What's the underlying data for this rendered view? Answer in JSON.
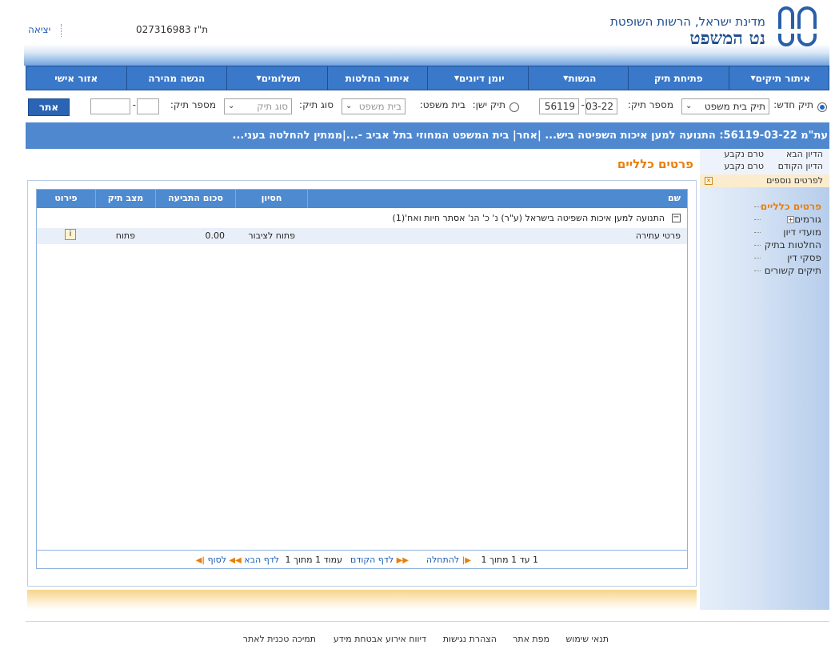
{
  "header": {
    "site_subtitle": "מדינת ישראל, הרשות השופטת",
    "site_title": "נט המשפט",
    "user_id": "ת\"ז 027316983",
    "logout": "יציאה"
  },
  "nav": [
    {
      "label": "איתור תיקים",
      "dropdown": true
    },
    {
      "label": "פתיחת תיק",
      "dropdown": false
    },
    {
      "label": "הגשות",
      "dropdown": true
    },
    {
      "label": "יומן דיונים",
      "dropdown": true
    },
    {
      "label": "איתור החלטות",
      "dropdown": false
    },
    {
      "label": "תשלומים",
      "dropdown": true
    },
    {
      "label": "הגשה מהירה",
      "dropdown": false
    },
    {
      "label": "אזור אישי",
      "dropdown": false
    }
  ],
  "search": {
    "new_case_label": "תיק חדש:",
    "new_case_type": "תיק בית משפט",
    "case_number_label": "מספר תיק:",
    "case_number_month": "03-22",
    "case_number_sep": "-",
    "case_number_id": "56119",
    "old_case_label": "תיק ישן:",
    "court_label": "בית משפט:",
    "court_placeholder": "בית משפט",
    "case_type_label": "סוג תיק:",
    "case_type_placeholder": "סוג תיק",
    "old_case_number_label": "מספר תיק:",
    "old_case_sep": "-",
    "go_button": "אתר"
  },
  "case_banner": "עת\"מ 56119-03-22: התנועה למען איכות השפיטה ביש... |אחר| בית המשפט המחוזי בתל אביב -...|ממתין להחלטה בעני...",
  "side": {
    "next_hearing_label": "הדיון הבא",
    "next_hearing_value": "טרם נקבע",
    "prev_hearing_label": "הדיון הקודם",
    "prev_hearing_value": "טרם נקבע",
    "more_details": "לפרטים נוספים",
    "tree": [
      {
        "label": "פרטים כלליים",
        "active": true,
        "expandable": false
      },
      {
        "label": "גורמים",
        "active": false,
        "expandable": true
      },
      {
        "label": "מועדי דיון",
        "active": false,
        "expandable": false
      },
      {
        "label": "החלטות בתיק",
        "active": false,
        "expandable": false
      },
      {
        "label": "פסקי דין",
        "active": false,
        "expandable": false
      },
      {
        "label": "תיקים קשורים",
        "active": false,
        "expandable": false
      }
    ]
  },
  "main": {
    "section_title": "פרטים כלליים",
    "columns": [
      "שם",
      "חסיון",
      "סכום התביעה",
      "מצב תיק",
      "פירוט"
    ],
    "group_label": "התנועה למען איכות השפיטה בישראל (ע\"ר) נ' כ' הנ' אסתר חיות ואח'(1)",
    "rows": [
      {
        "name": "פרטי עתירה",
        "privacy": "פתוח לציבור",
        "amount": "0.00",
        "status": "פתוח"
      }
    ],
    "pager": {
      "range": "1 עד 1 מתוך 1",
      "first": "להתחלה",
      "prev": "לדף הקודם",
      "page": "עמוד 1 מתוך 1",
      "next": "לדף הבא",
      "last": "לסוף"
    }
  },
  "footer": [
    "תנאי שימוש",
    "מפת אתר",
    "הצהרת נגישות",
    "דיווח אירוע אבטחת מידע",
    "תמיכה טכנית לאתר"
  ],
  "colors": {
    "nav_blue": "#3a78c9",
    "banner_blue": "#4f88cf",
    "accent_orange": "#e97f0b",
    "link_blue": "#1c5db5"
  }
}
